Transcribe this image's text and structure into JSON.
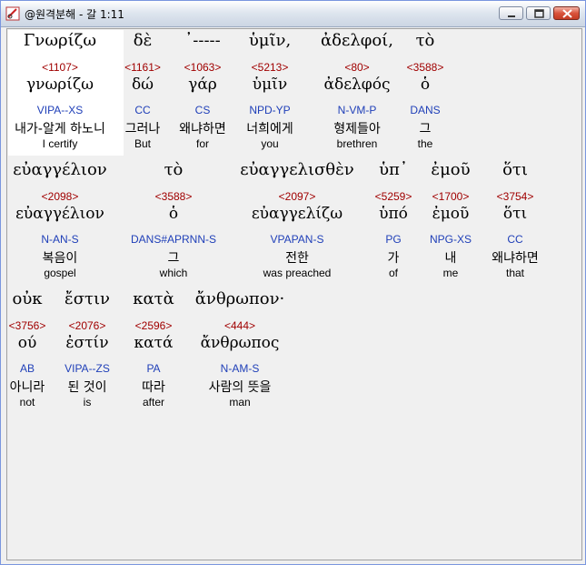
{
  "window": {
    "title": "@원격분해 - 갈 1:11",
    "colors": {
      "strong_number": "#a00000",
      "parsing": "#1f3fb8",
      "highlight": "#ffffff"
    }
  },
  "lines": [
    {
      "words": [
        {
          "greek": "Γνωρίζω",
          "num": "<1107>",
          "lemma": "γνωρίζω",
          "parse": "VIPA--XS",
          "kor": "내가-알게 하노니",
          "eng": "I certify"
        },
        {
          "greek": "δὲ",
          "num": "<1161>",
          "lemma": "δώ",
          "parse": "CC",
          "kor": "그러나",
          "eng": "But"
        },
        {
          "greek": "᾿-----",
          "num": "<1063>",
          "lemma": "γάρ",
          "parse": "CS",
          "kor": "왜냐하면",
          "eng": "for"
        },
        {
          "greek": "ὑμῖν,",
          "num": "<5213>",
          "lemma": "ὑμῖν",
          "parse": "NPD-YP",
          "kor": "너희에게",
          "eng": "you"
        },
        {
          "greek": "ἀδελφοί,",
          "num": "<80>",
          "lemma": "ἀδελφός",
          "parse": "N-VM-P",
          "kor": "형제들아",
          "eng": "brethren"
        },
        {
          "greek": "τὸ",
          "num": "<3588>",
          "lemma": "ὁ",
          "parse": "DANS",
          "kor": "그",
          "eng": "the"
        }
      ]
    },
    {
      "words": [
        {
          "greek": "εὐαγγέλιον",
          "num": "<2098>",
          "lemma": "εὐαγγέλιον",
          "parse": "N-AN-S",
          "kor": "복음이",
          "eng": "gospel"
        },
        {
          "greek": "τὸ",
          "num": "<3588>",
          "lemma": "ὁ",
          "parse": "DANS#APRNN-S",
          "kor": "그",
          "eng": "which"
        },
        {
          "greek": "εὐαγγελισθὲν",
          "num": "<2097>",
          "lemma": "εὐαγγελίζω",
          "parse": "VPAPAN-S",
          "kor": "전한",
          "eng": "was preached"
        },
        {
          "greek": "ὑπ᾿",
          "num": "<5259>",
          "lemma": "ὑπό",
          "parse": "PG",
          "kor": "가",
          "eng": "of"
        },
        {
          "greek": "ἐμοῦ",
          "num": "<1700>",
          "lemma": "ἐμοῦ",
          "parse": "NPG-XS",
          "kor": "내",
          "eng": "me"
        },
        {
          "greek": "ὅτι",
          "num": "<3754>",
          "lemma": "ὅτι",
          "parse": "CC",
          "kor": "왜냐하면",
          "eng": "that"
        }
      ]
    },
    {
      "words": [
        {
          "greek": "οὐκ",
          "num": "<3756>",
          "lemma": "ού",
          "parse": "AB",
          "kor": "아니라",
          "eng": "not"
        },
        {
          "greek": "ἔστιν",
          "num": "<2076>",
          "lemma": "ἐστίν",
          "parse": "VIPA--ZS",
          "kor": "된 것이",
          "eng": "is"
        },
        {
          "greek": "κατὰ",
          "num": "<2596>",
          "lemma": "κατά",
          "parse": "PA",
          "kor": "따라",
          "eng": "after"
        },
        {
          "greek": "ἄνθρωπον·",
          "num": "<444>",
          "lemma": "ἄνθρωπος",
          "parse": "N-AM-S",
          "kor": "사람의 뜻을",
          "eng": "man"
        }
      ]
    }
  ]
}
